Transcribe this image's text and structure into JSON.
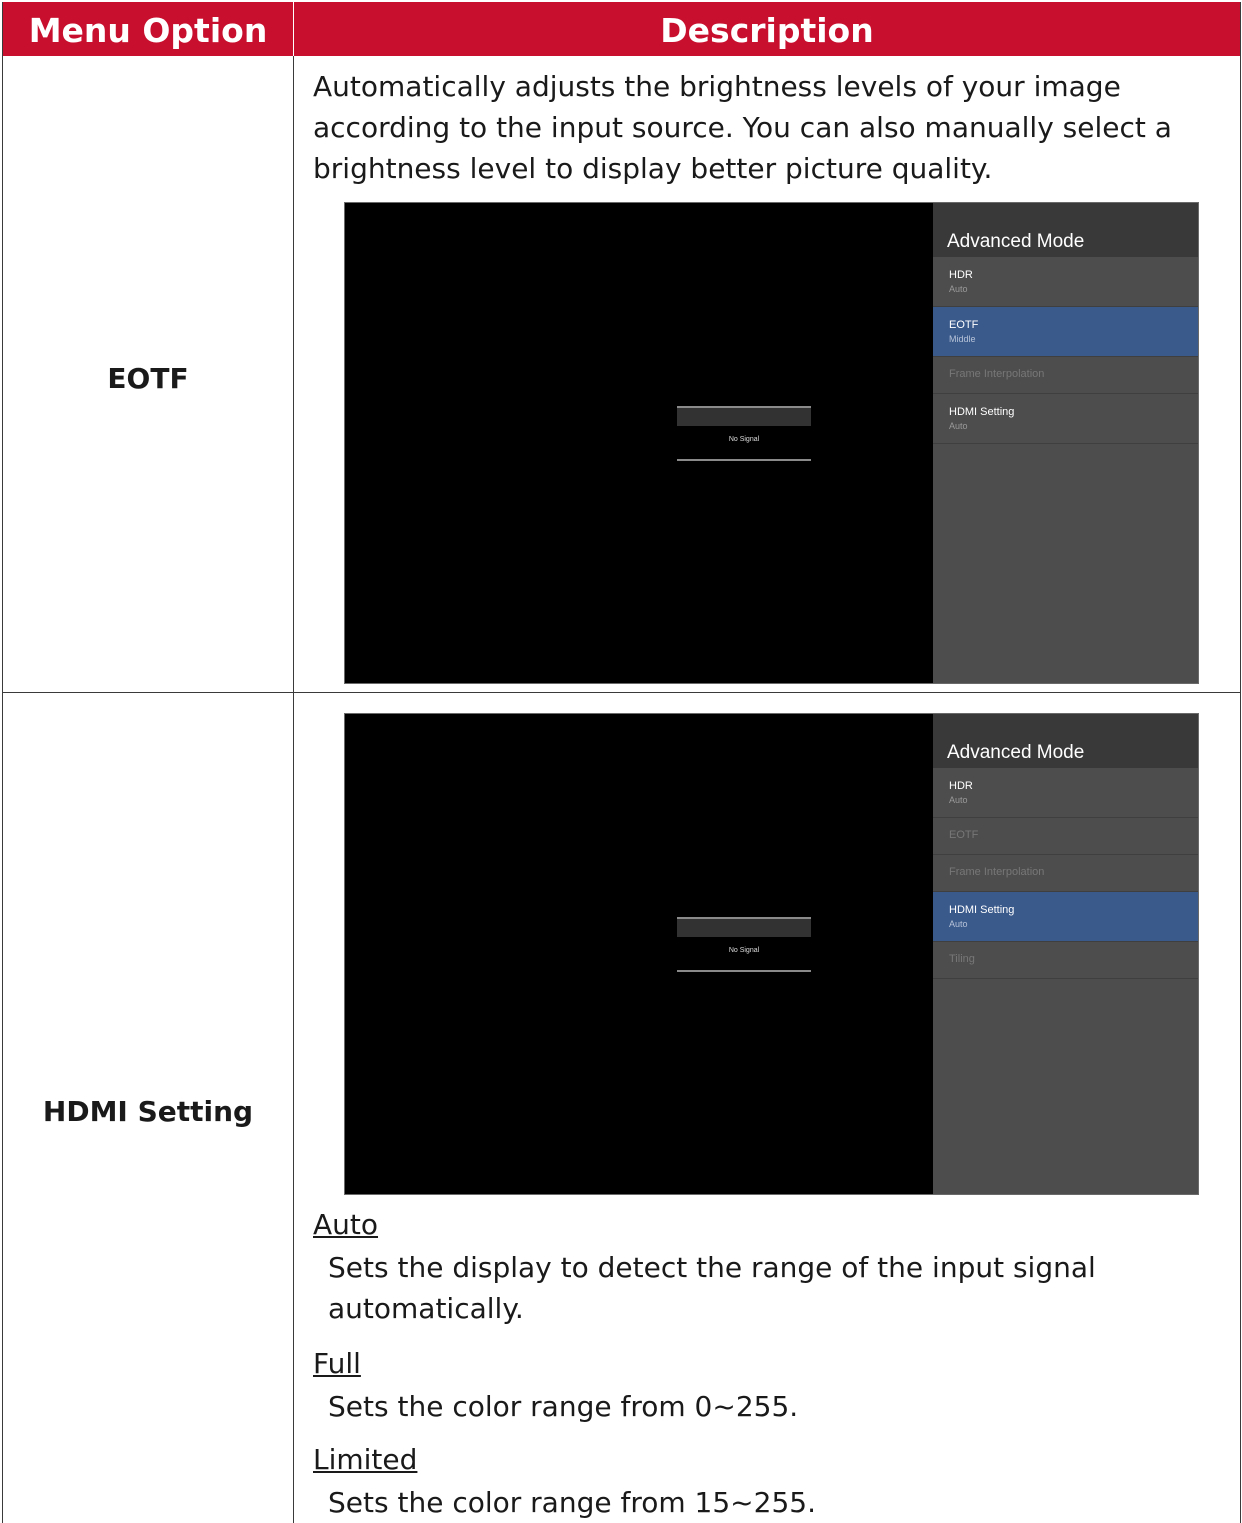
{
  "header": {
    "menu_option": "Menu Option",
    "description": "Description"
  },
  "rows": [
    {
      "option": "EOTF",
      "description": "Automatically adjusts the brightness levels of your image according to the input source. You can also manually select a brightness level to display better picture quality.",
      "screen": {
        "no_signal": "No Signal",
        "panel_title": "Advanced Mode",
        "items": [
          {
            "label": "HDR",
            "value": "Auto",
            "state": "normal"
          },
          {
            "label": "EOTF",
            "value": "Middle",
            "state": "selected"
          },
          {
            "label": "Frame Interpolation",
            "value": "",
            "state": "disabled"
          },
          {
            "label": "HDMI Setting",
            "value": "Auto",
            "state": "normal"
          }
        ]
      }
    },
    {
      "option": "HDMI Setting",
      "screen": {
        "no_signal": "No Signal",
        "panel_title": "Advanced Mode",
        "items": [
          {
            "label": "HDR",
            "value": "Auto",
            "state": "normal"
          },
          {
            "label": "EOTF",
            "value": "",
            "state": "disabled"
          },
          {
            "label": "Frame Interpolation",
            "value": "",
            "state": "disabled"
          },
          {
            "label": "HDMI Setting",
            "value": "Auto",
            "state": "selected"
          },
          {
            "label": "Tiling",
            "value": "",
            "state": "disabled"
          }
        ]
      },
      "options": [
        {
          "name": "Auto",
          "description": "Sets the display to detect the range of the input signal automatically."
        },
        {
          "name": "Full",
          "description": "Sets the color range from 0~255."
        },
        {
          "name": "Limited",
          "description": "Sets the color range from 15~255."
        }
      ]
    }
  ],
  "colors": {
    "header_bg": "#c8102e",
    "selected_item": "#3a5a8c",
    "panel_bg": "#4d4d4d"
  }
}
